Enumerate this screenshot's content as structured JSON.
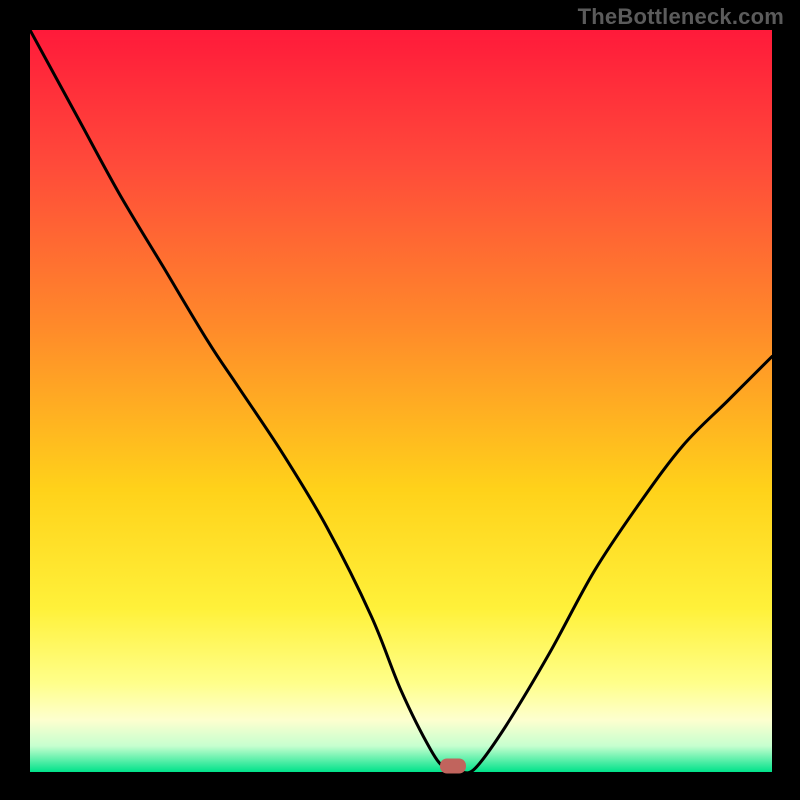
{
  "watermark": "TheBottleneck.com",
  "chart_data": {
    "type": "line",
    "title": "",
    "xlabel": "",
    "ylabel": "",
    "xlim": [
      0,
      100
    ],
    "ylim": [
      0,
      100
    ],
    "grid": false,
    "legend": false,
    "gradient_stops": [
      {
        "offset": 0,
        "color": "#ff1a3a"
      },
      {
        "offset": 0.18,
        "color": "#ff4a3a"
      },
      {
        "offset": 0.4,
        "color": "#ff8a2a"
      },
      {
        "offset": 0.62,
        "color": "#ffd21a"
      },
      {
        "offset": 0.78,
        "color": "#fff13a"
      },
      {
        "offset": 0.88,
        "color": "#ffff8a"
      },
      {
        "offset": 0.93,
        "color": "#fdffcf"
      },
      {
        "offset": 0.965,
        "color": "#c6ffcf"
      },
      {
        "offset": 1.0,
        "color": "#00e28a"
      }
    ],
    "series": [
      {
        "name": "bottleneck-curve",
        "x": [
          0,
          6,
          12,
          18,
          24,
          28,
          34,
          40,
          46,
          50,
          54,
          56,
          58,
          60,
          64,
          70,
          76,
          82,
          88,
          94,
          100
        ],
        "y": [
          100,
          89,
          78,
          68,
          58,
          52,
          43,
          33,
          21,
          11,
          3,
          0.5,
          0,
          0.5,
          6,
          16,
          27,
          36,
          44,
          50,
          56
        ]
      }
    ],
    "marker": {
      "x": 57,
      "y": 0.8,
      "color": "#c1645d"
    }
  }
}
